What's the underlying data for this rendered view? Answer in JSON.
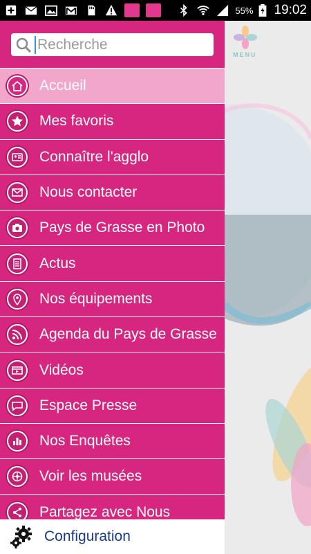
{
  "status_bar": {
    "battery": "55%",
    "time": "19:02",
    "icons": [
      "plus-icon",
      "mail-icon",
      "gallery-icon",
      "gmail-icon",
      "sd-card-icon",
      "warning-icon",
      "app-badge-icon",
      "app-badge-icon",
      "bluetooth-icon",
      "wifi-icon",
      "signal-icon",
      "battery-icon"
    ]
  },
  "search": {
    "placeholder": "Recherche"
  },
  "drawer": {
    "items": [
      {
        "label": "Accueil",
        "icon": "home-icon",
        "active": true
      },
      {
        "label": "Mes favoris",
        "icon": "star-icon",
        "active": false
      },
      {
        "label": "Connaître l'agglo",
        "icon": "info-card-icon",
        "active": false
      },
      {
        "label": "Nous contacter",
        "icon": "mail-icon",
        "active": false
      },
      {
        "label": "Pays de Grasse en Photo",
        "icon": "camera-icon",
        "active": false
      },
      {
        "label": "Actus",
        "icon": "document-icon",
        "active": false
      },
      {
        "label": "Nos équipements",
        "icon": "location-pin-icon",
        "active": false
      },
      {
        "label": "Agenda du Pays de Grasse",
        "icon": "rss-icon",
        "active": false
      },
      {
        "label": "Vidéos",
        "icon": "video-icon",
        "active": false
      },
      {
        "label": "Espace Presse",
        "icon": "speech-bubble-icon",
        "active": false
      },
      {
        "label": "Nos Enquêtes",
        "icon": "bar-chart-icon",
        "active": false
      },
      {
        "label": "Voir les musées",
        "icon": "compass-icon",
        "active": false
      },
      {
        "label": "Partagez avec Nous",
        "icon": "share-icon",
        "active": false
      }
    ]
  },
  "config": {
    "label": "Configuration",
    "icon": "gears-icon"
  },
  "background": {
    "menu_label": "MENU"
  },
  "colors": {
    "drawer": "#d7267f",
    "active_item": "#f2a6cc",
    "config_text": "#1b3a8c",
    "menu_accent": "#8fc8c5"
  }
}
